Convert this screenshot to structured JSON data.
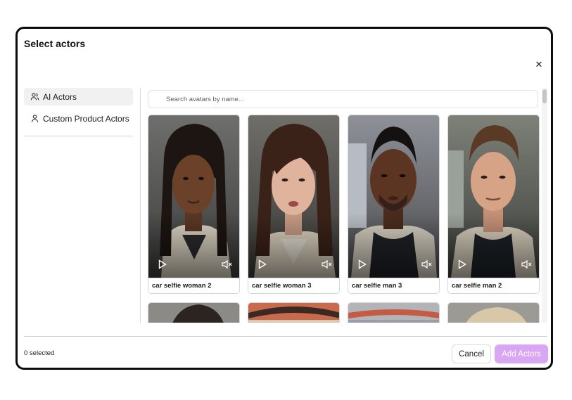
{
  "dialog": {
    "title": "Select actors"
  },
  "sidebar": {
    "items": [
      {
        "label": "AI Actors",
        "icon": "users-icon",
        "active": true
      },
      {
        "label": "Custom Product Actors",
        "icon": "user-icon",
        "active": false
      }
    ]
  },
  "search": {
    "placeholder": "Search avatars by name..."
  },
  "actors": [
    {
      "name": "car selfie woman 2"
    },
    {
      "name": "car selfie woman 3"
    },
    {
      "name": "car selfie man 3"
    },
    {
      "name": "car selfie man 2"
    }
  ],
  "footer": {
    "selected_text": "0 selected",
    "cancel_label": "Cancel",
    "add_label": "Add Actors"
  },
  "colors": {
    "accent": "#d9a6f3",
    "modal_border": "#0b0b0b"
  }
}
